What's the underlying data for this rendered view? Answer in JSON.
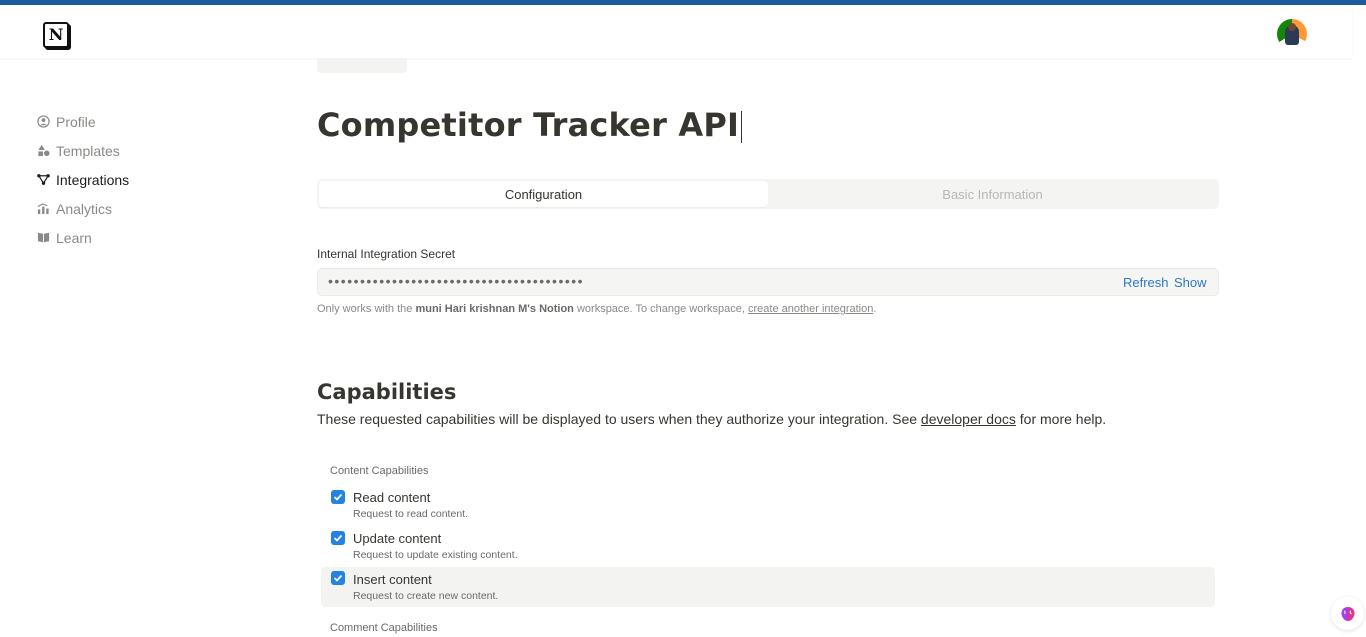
{
  "colors": {
    "accent_bar": "#1d5a9e",
    "link": "#2d79c7",
    "checkbox": "#2383e2"
  },
  "sidebar": {
    "items": [
      {
        "label": "Profile",
        "icon": "profile-icon",
        "active": false
      },
      {
        "label": "Templates",
        "icon": "templates-icon",
        "active": false
      },
      {
        "label": "Integrations",
        "icon": "integrations-icon",
        "active": true
      },
      {
        "label": "Analytics",
        "icon": "analytics-icon",
        "active": false
      },
      {
        "label": "Learn",
        "icon": "book-icon",
        "active": false
      }
    ]
  },
  "page": {
    "title": "Competitor Tracker API"
  },
  "tabs": [
    {
      "label": "Configuration",
      "active": true
    },
    {
      "label": "Basic Information",
      "active": false
    }
  ],
  "secret": {
    "label": "Internal Integration Secret",
    "masked_value": "••••••••••••••••••••••••••••••••••••••••",
    "refresh_label": "Refresh",
    "show_label": "Show",
    "hint_prefix": "Only works with the",
    "workspace": "muni Hari krishnan M's Notion",
    "hint_middle": "workspace. To change workspace,",
    "hint_link": "create another integration",
    "hint_suffix": "."
  },
  "capabilities": {
    "title": "Capabilities",
    "desc_prefix": "These requested capabilities will be displayed to users when they authorize your integration. See",
    "desc_link": "developer docs",
    "desc_suffix": "for more help.",
    "content_heading": "Content Capabilities",
    "content_items": [
      {
        "label": "Read content",
        "sub": "Request to read content.",
        "checked": true
      },
      {
        "label": "Update content",
        "sub": "Request to update existing content.",
        "checked": true
      },
      {
        "label": "Insert content",
        "sub": "Request to create new content.",
        "checked": true
      }
    ],
    "comment_heading": "Comment Capabilities"
  }
}
